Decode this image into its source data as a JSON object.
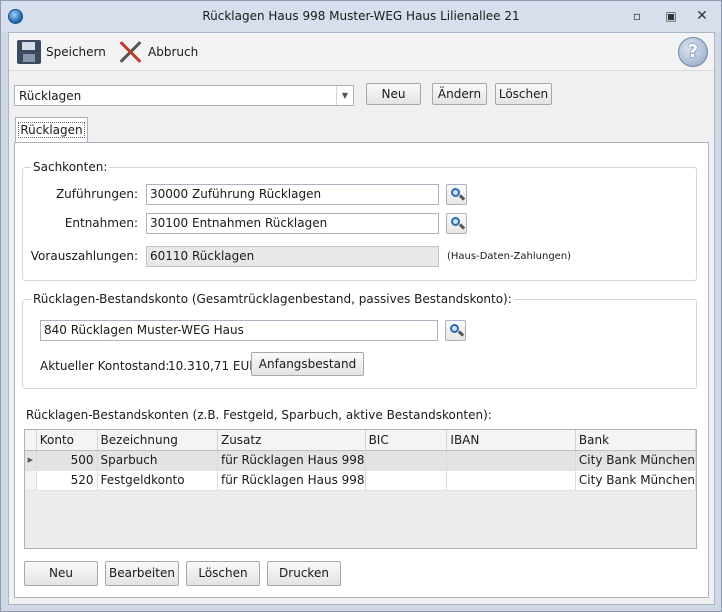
{
  "window": {
    "title": "Rücklagen Haus 998  Muster-WEG Haus Lilienallee 21",
    "controls": [
      "minimize",
      "restore",
      "close"
    ]
  },
  "toolbar": {
    "save_label": "Speichern",
    "cancel_label": "Abbruch",
    "help_icon": "help-icon"
  },
  "selector": {
    "value": "Rücklagen",
    "buttons": [
      "Neu",
      "Ändern",
      "Löschen"
    ]
  },
  "tab": {
    "label": "Rücklagen"
  },
  "sachkonten": {
    "title": "Sachkonten:",
    "zufuehrungen_label": "Zuführungen:",
    "zufuehrungen_value": "30000 Zuführung Rücklagen",
    "entnahmen_label": "Entnahmen:",
    "entnahmen_value": "30100 Entnahmen Rücklagen",
    "voraus_label": "Vorauszahlungen:",
    "voraus_value": "60110 Rücklagen",
    "voraus_note": "(Haus-Daten-Zahlungen)"
  },
  "bestandskonto": {
    "title": "Rücklagen-Bestandskonto (Gesamtrücklagenbestand, passives Bestandskonto):",
    "account_value": "840 Rücklagen Muster-WEG Haus",
    "balance_label": "Aktueller Kontostand:",
    "balance_value": "10.310,71 EUR",
    "initial_button": "Anfangsbestand"
  },
  "bestandskonten": {
    "title": "Rücklagen-Bestandskonten (z.B. Festgeld, Sparbuch, aktive Bestandskonten):",
    "columns": [
      "Konto",
      "Bezeichnung",
      "Zusatz",
      "BIC",
      "IBAN",
      "Bank"
    ],
    "rows": [
      {
        "konto": "500",
        "bezeichnung": "Sparbuch",
        "zusatz": "für Rücklagen Haus 998",
        "bic": "",
        "iban": "",
        "bank": "City Bank München"
      },
      {
        "konto": "520",
        "bezeichnung": "Festgeldkonto",
        "zusatz": "für Rücklagen Haus 998",
        "bic": "",
        "iban": "",
        "bank": "City Bank München"
      }
    ]
  },
  "bottom_buttons": [
    "Neu",
    "Bearbeiten",
    "Löschen",
    "Drucken"
  ],
  "colors": {
    "titlebar": "#d6dfeb",
    "selected_row": "#e3e3e3"
  }
}
